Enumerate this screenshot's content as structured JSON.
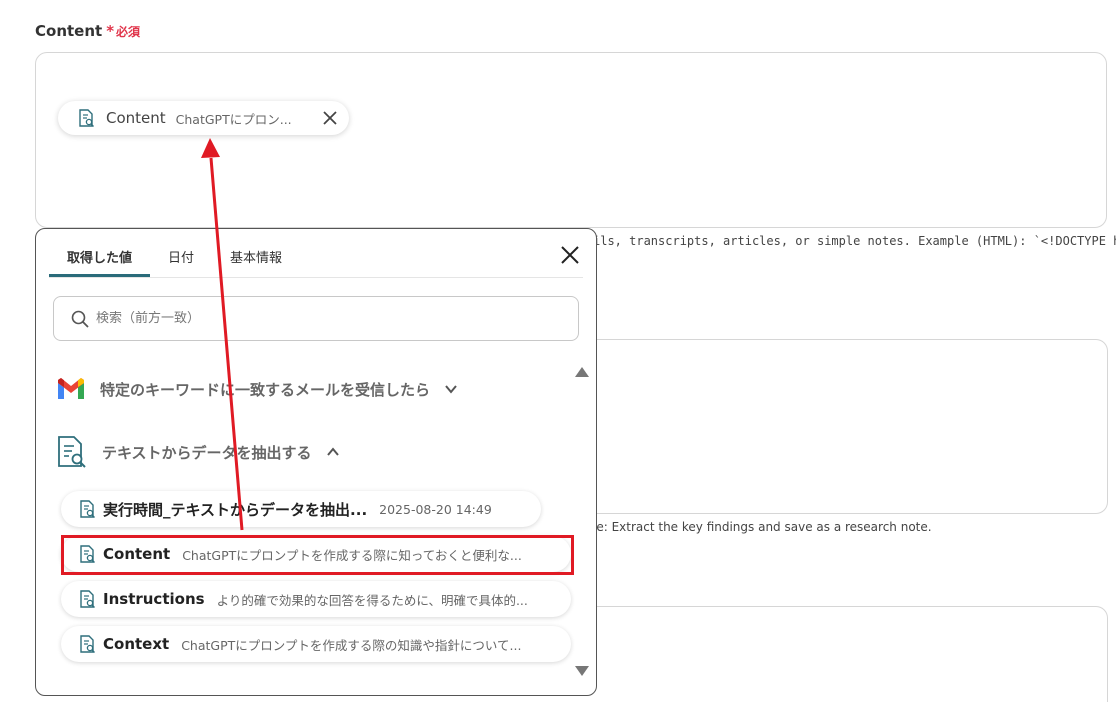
{
  "field": {
    "label": "Content",
    "required_star": "*",
    "required_text": "必須"
  },
  "chip": {
    "name": "Content",
    "value": "ChatGPTにプロン..."
  },
  "help_texts": {
    "first": "ils, transcripts, articles, or simple notes. Example (HTML): `<!DOCTYPE html>",
    "second": "le: Extract the key findings and save as a research note."
  },
  "popup": {
    "tabs": [
      {
        "label": "取得した値",
        "active": true
      },
      {
        "label": "日付",
        "active": false
      },
      {
        "label": "基本情報",
        "active": false
      }
    ],
    "search_placeholder": "検索（前方一致）",
    "sections": [
      {
        "title": "特定のキーワードに一致するメールを受信したら",
        "icon": "gmail-icon",
        "expanded": false
      },
      {
        "title": "テキストからデータを抽出する",
        "icon": "document-search-icon",
        "expanded": true
      }
    ],
    "items": [
      {
        "name": "実行時間_テキストからデータを抽出...",
        "value": "2025-08-20 14:49"
      },
      {
        "name": "Content",
        "value": "ChatGPTにプロンプトを作成する際に知っておくと便利な..."
      },
      {
        "name": "Instructions",
        "value": "より的確で効果的な回答を得るために、明確で具体的..."
      },
      {
        "name": "Context",
        "value": "ChatGPTにプロンプトを作成する際の知識や指針について..."
      }
    ]
  },
  "colors": {
    "required": "#e0344a",
    "annotation_red": "#e01a24",
    "tab_underline": "#2a6b7a",
    "icon_teal": "#2f6f7c"
  }
}
